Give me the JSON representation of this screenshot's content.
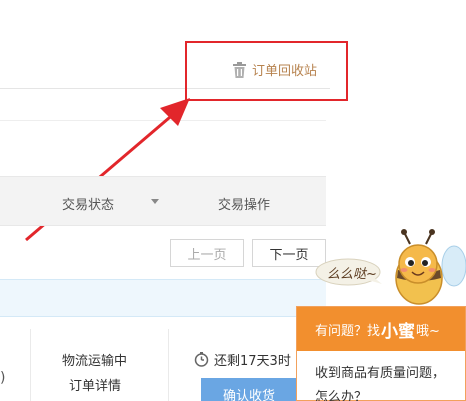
{
  "recycle_bin": {
    "label": "订单回收站",
    "icon": "trash-icon"
  },
  "table_header": {
    "status_label": "交易状态",
    "action_label": "交易操作"
  },
  "pagination": {
    "prev_label": "上一页",
    "next_label": "下一页"
  },
  "order_row": {
    "paren_text": ")",
    "logistics_status": "物流运输中",
    "detail_link": "订单详情",
    "time_remaining": "还剩17天3时",
    "confirm_button": "确认收货"
  },
  "help_widget": {
    "bubble_text": "么么哒~",
    "header_prefix": "有问题？找",
    "header_name": "小蜜",
    "header_suffix": "哦~",
    "body_line1": "收到商品有质量问题，",
    "body_line2": "怎么办？"
  },
  "colors": {
    "highlight_red": "#e2262b",
    "recycle_text": "#b7834f",
    "help_orange": "#f28f2e",
    "confirm_blue": "#6aa6e3"
  }
}
